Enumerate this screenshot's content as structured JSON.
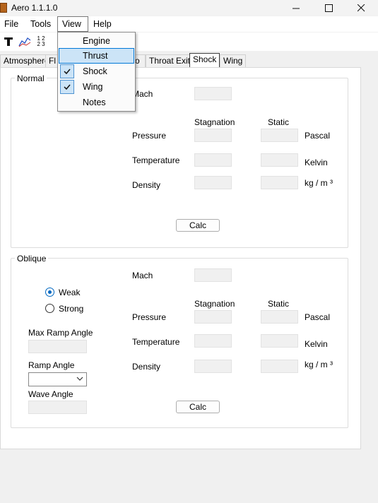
{
  "window": {
    "title": "Aero 1.1.1.0"
  },
  "menubar": {
    "file": "File",
    "tools": "Tools",
    "view": "View",
    "help": "Help"
  },
  "toolbar": {
    "numbers_icon_top": "1 2",
    "numbers_icon_bottom": "2 3"
  },
  "tabs": [
    "Atmosphere",
    "Fl",
    "o",
    "Throat Exit",
    "Shock",
    "Wing"
  ],
  "active_tab": "Shock",
  "view_menu": {
    "items": [
      {
        "label": "Engine",
        "checked": false,
        "highlighted": false
      },
      {
        "label": "Thrust",
        "checked": false,
        "highlighted": true
      },
      {
        "label": "Shock",
        "checked": true,
        "highlighted": false
      },
      {
        "label": "Wing",
        "checked": true,
        "highlighted": false
      },
      {
        "label": "Notes",
        "checked": false,
        "highlighted": false
      }
    ]
  },
  "normal": {
    "title": "Normal",
    "mach": "Mach",
    "stagnation": "Stagnation",
    "static": "Static",
    "pressure": "Pressure",
    "temperature": "Temperature",
    "density": "Density",
    "unit_pressure": "Pascal",
    "unit_temperature": "Kelvin",
    "unit_density": "kg / m ³",
    "calc": "Calc"
  },
  "oblique": {
    "title": "Oblique",
    "mach": "Mach",
    "weak": "Weak",
    "strong": "Strong",
    "selected": "Weak",
    "max_ramp_angle": "Max Ramp Angle",
    "ramp_angle": "Ramp Angle",
    "wave_angle": "Wave Angle",
    "stagnation": "Stagnation",
    "static": "Static",
    "pressure": "Pressure",
    "temperature": "Temperature",
    "density": "Density",
    "unit_pressure": "Pascal",
    "unit_temperature": "Kelvin",
    "unit_density": "kg / m ³",
    "calc": "Calc"
  }
}
